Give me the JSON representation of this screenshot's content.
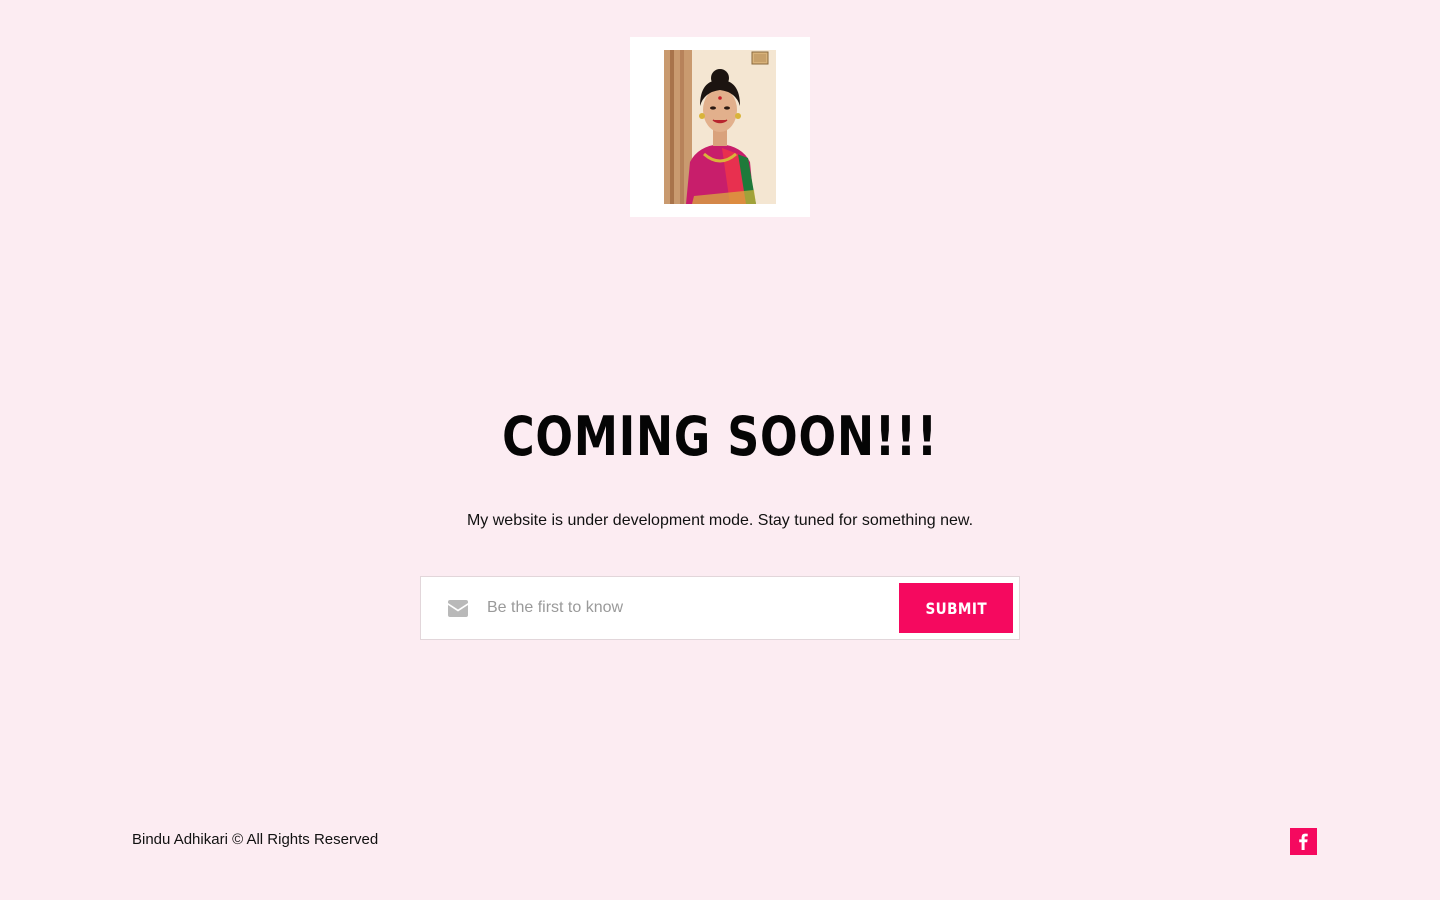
{
  "colors": {
    "background": "#fcecf2",
    "accent": "#f5095f",
    "heading": "#050505",
    "form_background": "#ffffff"
  },
  "logo": {
    "icon": "portrait-photo"
  },
  "hero": {
    "title": "COMING SOON!!!",
    "subtitle": "My website is under development mode. Stay tuned for something new."
  },
  "subscribe": {
    "icon": "envelope-icon",
    "placeholder": "Be the first to know",
    "value": "",
    "submit_label": "SUBMIT"
  },
  "footer": {
    "copyright": "Bindu Adhikari © All Rights Reserved",
    "social": [
      {
        "icon": "facebook-icon"
      }
    ]
  }
}
